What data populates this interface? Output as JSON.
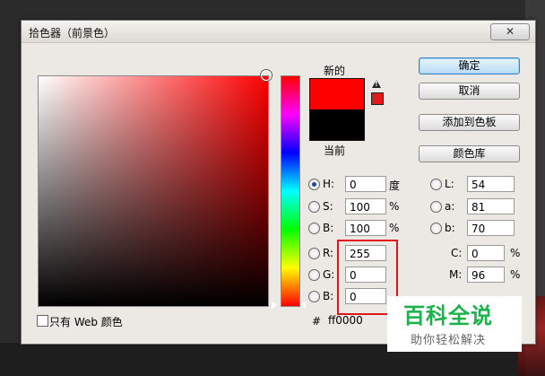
{
  "window": {
    "title": "拾色器（前景色）",
    "close": "✕"
  },
  "preview": {
    "new_label": "新的",
    "current_label": "当前",
    "new_color": "#ff0000",
    "current_color": "#000000",
    "gamut_color": "#e01a1a"
  },
  "buttons": {
    "ok": "确定",
    "cancel": "取消",
    "add_swatch": "添加到色板",
    "libraries": "颜色库"
  },
  "hsb": {
    "h": {
      "label": "H:",
      "value": "0",
      "unit": "度"
    },
    "s": {
      "label": "S:",
      "value": "100",
      "unit": "%"
    },
    "b": {
      "label": "B:",
      "value": "100",
      "unit": "%"
    }
  },
  "rgb": {
    "r": {
      "label": "R:",
      "value": "255"
    },
    "g": {
      "label": "G:",
      "value": "0"
    },
    "b": {
      "label": "B:",
      "value": "0"
    }
  },
  "lab": {
    "l": {
      "label": "L:",
      "value": "54"
    },
    "a": {
      "label": "a:",
      "value": "81"
    },
    "b": {
      "label": "b:",
      "value": "70"
    }
  },
  "cmyk": {
    "c": {
      "label": "C:",
      "value": "0",
      "unit": "%"
    },
    "m": {
      "label": "M:",
      "value": "96",
      "unit": "%"
    }
  },
  "hex": {
    "label": "#",
    "value": "ff0000"
  },
  "web_only": {
    "label": "只有 Web 颜色"
  },
  "watermark": {
    "title": "百科全说",
    "subtitle": "助你轻松解决"
  },
  "colors": {
    "accent_red": "#e0141b",
    "watermark_green": "#1bb24a"
  }
}
